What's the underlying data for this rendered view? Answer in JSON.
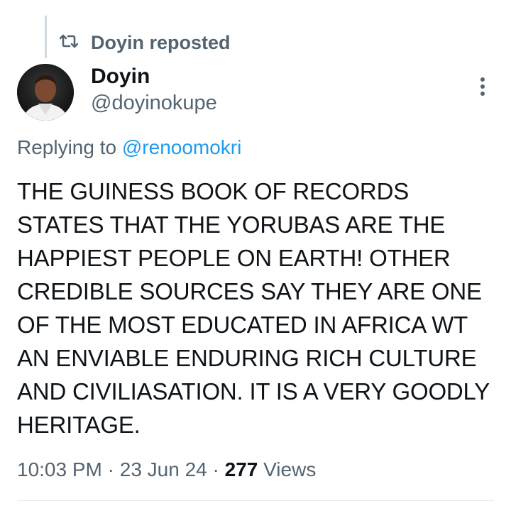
{
  "repost": {
    "icon": "repost-icon",
    "text": "Doyin reposted"
  },
  "author": {
    "name": "Doyin",
    "handle": "@doyinokupe",
    "avatar": "avatar"
  },
  "reply": {
    "prefix": "Replying to ",
    "handle": "@renoomokri"
  },
  "tweet": {
    "text": "THE GUINESS BOOK OF RECORDS STATES THAT THE YORUBAS ARE THE HAPPIEST PEOPLE ON EARTH! OTHER CREDIBLE SOURCES SAY THEY ARE ONE OF THE MOST EDUCATED IN AFRICA WT AN ENVIABLE ENDURING RICH CULTURE AND CIVILIASATION. IT IS A VERY GOODLY HERITAGE."
  },
  "meta": {
    "time": "10:03 PM",
    "sep1": " · ",
    "date": "23 Jun 24",
    "sep2": " · ",
    "views_count": "277",
    "views_label": " Views"
  },
  "colors": {
    "text": "#0f1419",
    "secondary": "#536471",
    "link": "#1d9bf0",
    "divider": "#e1e8ed"
  },
  "icons": {
    "more": "more-vertical-icon"
  }
}
